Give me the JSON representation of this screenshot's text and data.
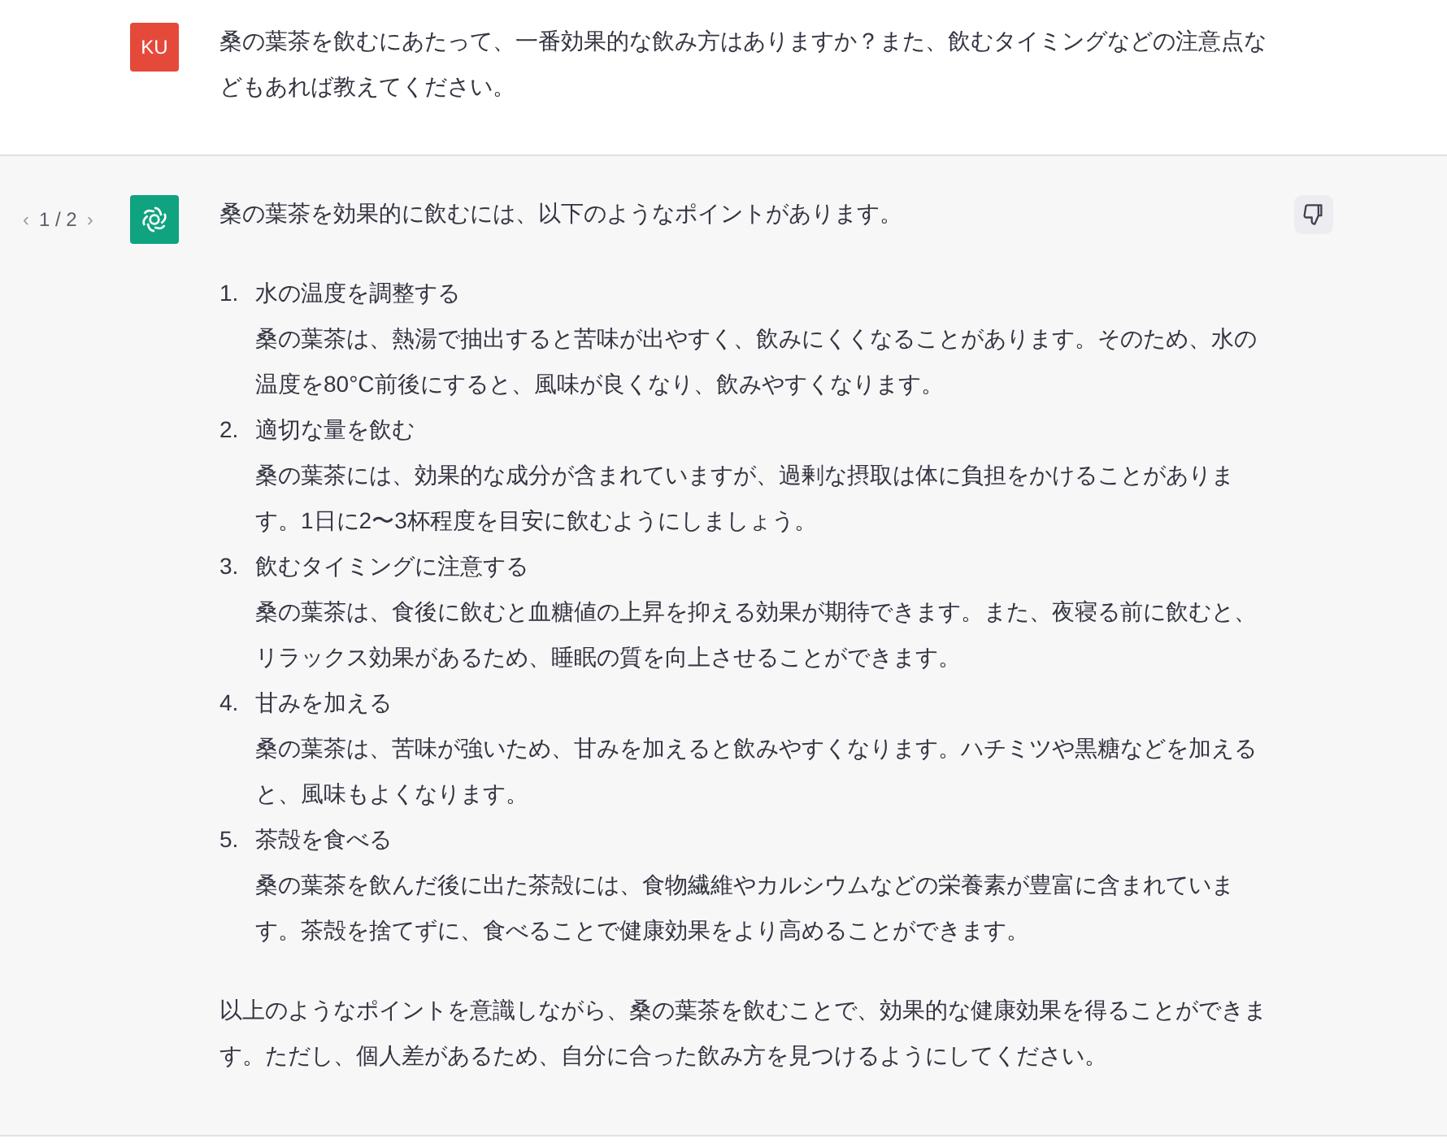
{
  "user_message": {
    "avatar": "KU",
    "text": "桑の葉茶を飲むにあたって、一番効果的な飲み方はありますか？また、飲むタイミングなどの注意点などもあれば教えてください。"
  },
  "assistant_message": {
    "pager": {
      "prev": "‹",
      "label": "1 / 2",
      "next": "›"
    },
    "intro": "桑の葉茶を効果的に飲むには、以下のようなポイントがあります。",
    "points": [
      {
        "number": "1.",
        "title": "水の温度を調整する",
        "body": "桑の葉茶は、熱湯で抽出すると苦味が出やすく、飲みにくくなることがあります。そのため、水の温度を80°C前後にすると、風味が良くなり、飲みやすくなります。"
      },
      {
        "number": "2.",
        "title": "適切な量を飲む",
        "body": "桑の葉茶には、効果的な成分が含まれていますが、過剰な摂取は体に負担をかけることがあります。1日に2〜3杯程度を目安に飲むようにしましょう。"
      },
      {
        "number": "3.",
        "title": "飲むタイミングに注意する",
        "body": "桑の葉茶は、食後に飲むと血糖値の上昇を抑える効果が期待できます。また、夜寝る前に飲むと、リラックス効果があるため、睡眠の質を向上させることができます。"
      },
      {
        "number": "4.",
        "title": "甘みを加える",
        "body": "桑の葉茶は、苦味が強いため、甘みを加えると飲みやすくなります。ハチミツや黒糖などを加えると、風味もよくなります。"
      },
      {
        "number": "5.",
        "title": "茶殻を食べる",
        "body": "桑の葉茶を飲んだ後に出た茶殻には、食物繊維やカルシウムなどの栄養素が豊富に含まれています。茶殻を捨てずに、食べることで健康効果をより高めることができます。"
      }
    ],
    "conclusion": "以上のようなポイントを意識しながら、桑の葉茶を飲むことで、効果的な健康効果を得ることができます。ただし、個人差があるため、自分に合った飲み方を見つけるようにしてください。"
  }
}
